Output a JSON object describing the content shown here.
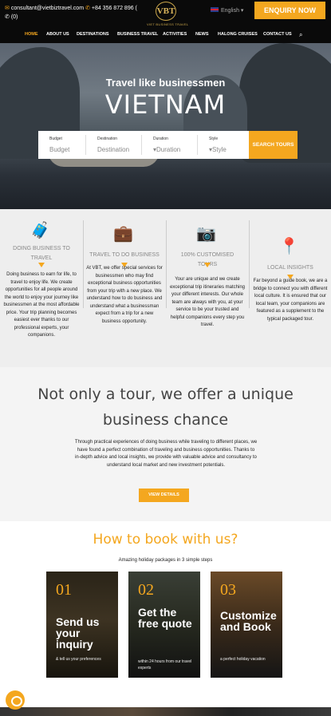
{
  "topbar": {
    "email": "consultant@vietbiztravel.com",
    "phone": "+84 356 872 896 (",
    "whatsapp": "(0)",
    "logo_text": "VBT",
    "logo_tag": "VIET BUSINESS TRAVEL",
    "language": "English",
    "enquiry_label": "ENQUIRY NOW",
    "accent": "#f4a71f"
  },
  "nav": {
    "items": [
      "HOME",
      "ABOUT US",
      "DESTINATIONS",
      "BUSINESS TRAVEL",
      "ACTIVITIES",
      "NEWS",
      "HALONG CRUISES",
      "CONTACT US"
    ],
    "active": "HOME",
    "search_icon": "search-icon"
  },
  "hero": {
    "title": "Travel like businessmen",
    "big": "VIETNAM",
    "fields": [
      {
        "label": "Budget",
        "value": "Budget"
      },
      {
        "label": "Destination",
        "value": "Destination"
      },
      {
        "label": "Duration",
        "value": "Duration"
      },
      {
        "label": "Style",
        "value": "Style"
      }
    ],
    "search_label": "SEARCH TOURS"
  },
  "features": [
    {
      "icon": "luggage-icon",
      "title": "DOING BUSINESS TO TRAVEL",
      "desc": "Doing business to earn for life, to travel to enjoy life. We create opportunities for all people around the world to enjoy your journey like businessmen at the most affordable price. Your trip planning becomes easiest ever thanks to our professional experts, your companions."
    },
    {
      "icon": "briefcase-icon",
      "title": "TRAVEL TO DO BUSINESS",
      "desc": "At VBT, we offer special services for businessmen who may find exceptional business opportunities from your trip with a new place. We understand how to do business and understand what a businessman expect from a trip for a new business opportunity."
    },
    {
      "icon": "camera-icon",
      "title": "100% CUSTOMISED TOURS",
      "desc": "Your are unique and we create exceptional trip itineraries matching your different interests. Our whole team are always with you, at your service to be your trusted and helpful companions every step you travel."
    },
    {
      "icon": "location-icon",
      "title": "LOCAL INSIGHTS",
      "desc": "Far beyond a guide book, we are a bridge to connect you with different local culture. It is ensured that our local team, your companions are featured as a supplement to the typical packaged tour."
    }
  ],
  "chance": {
    "heading": "Not only a tour, we offer a unique business chance",
    "text": "Through practical experiences of doing business while traveling to different places, we have found a perfect combination of traveling and business opportunities. Thanks to in-depth advice and local insights, we provide with valuable advice and consultancy to understand local market and new investment potentials.",
    "button": "VIEW DETAILS"
  },
  "howto": {
    "heading": "How to book with us?",
    "sub": "Amazing holiday packages in 3 simple steps",
    "cards": [
      {
        "num": "01",
        "title": "Send us your inquiry",
        "desc": "& tell us your preferences"
      },
      {
        "num": "02",
        "title": "Get the free quote",
        "desc": "within 24 hours from our travel experts"
      },
      {
        "num": "03",
        "title": "Customize and Book",
        "desc": "a perfect holiday vacation"
      }
    ]
  }
}
